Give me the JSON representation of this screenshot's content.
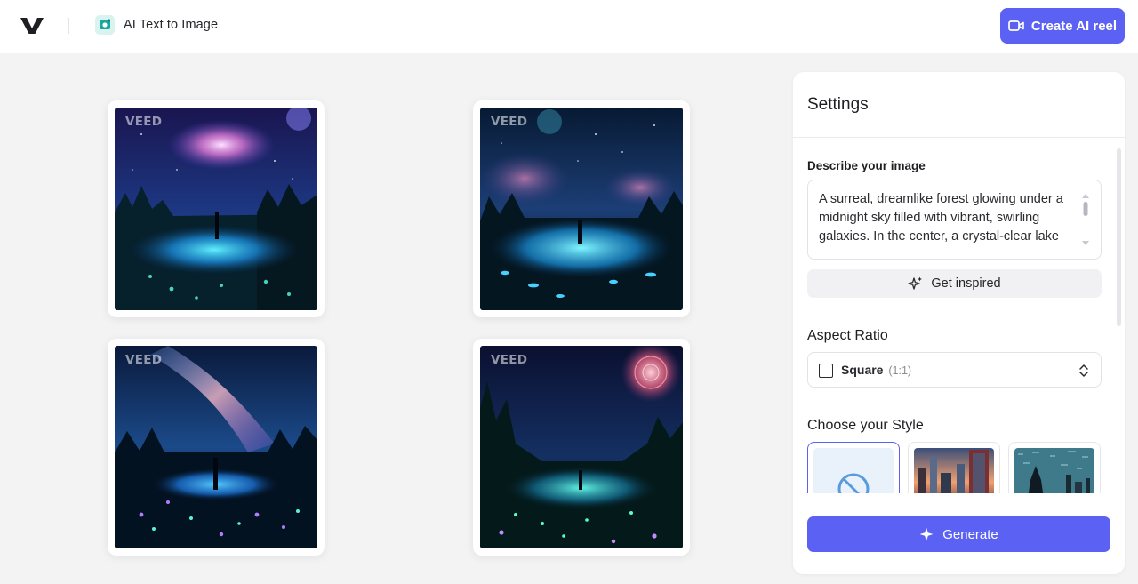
{
  "header": {
    "tool_title": "AI Text to Image",
    "create_reel_label": "Create AI reel"
  },
  "gallery": {
    "watermark": "VEED",
    "images": [
      {
        "name": "forest-galaxy-swirl"
      },
      {
        "name": "forest-night-lake"
      },
      {
        "name": "forest-milky-way"
      },
      {
        "name": "forest-spiral-sky"
      }
    ]
  },
  "settings": {
    "title": "Settings",
    "describe_label": "Describe your image",
    "prompt_text": "A surreal, dreamlike forest glowing under a midnight sky filled with vibrant, swirling galaxies. In the center, a crystal-clear lake",
    "get_inspired_label": "Get inspired",
    "aspect_ratio_label": "Aspect Ratio",
    "aspect_ratio_value": "Square",
    "aspect_ratio_sub": "(1:1)",
    "style_label": "Choose your Style",
    "generate_label": "Generate"
  },
  "colors": {
    "accent": "#5b61f2",
    "background": "#f3f3f4"
  }
}
